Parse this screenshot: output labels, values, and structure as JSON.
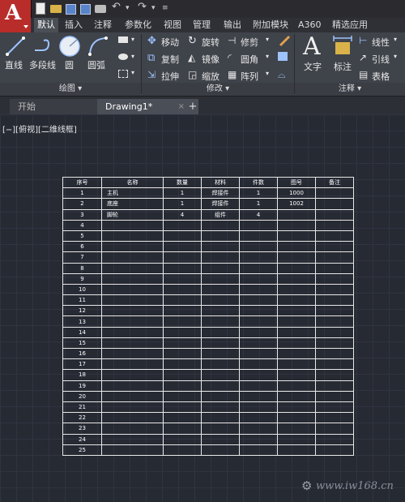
{
  "app": {
    "logo_letter": "A"
  },
  "ribbon_tabs": [
    "默认",
    "插入",
    "注释",
    "参数化",
    "视图",
    "管理",
    "输出",
    "附加模块",
    "A360",
    "精选应用"
  ],
  "draw_panel": {
    "title": "绘图 ▾",
    "tools": {
      "line": "直线",
      "polyline": "多段线",
      "circle": "圆",
      "arc": "圆弧"
    }
  },
  "modify_panel": {
    "title": "修改 ▾",
    "tools": {
      "move": "移动",
      "rotate": "旋转",
      "trim": "修剪",
      "copy": "复制",
      "mirror": "镜像",
      "fillet": "圆角",
      "stretch": "拉伸",
      "scale": "缩放",
      "array": "阵列"
    }
  },
  "annotation_panel": {
    "title": "注释 ▾",
    "tools": {
      "text": "文字",
      "dimension": "标注",
      "linear": "线性",
      "leader": "引线",
      "table": "表格"
    }
  },
  "file_tabs": {
    "start": "开始",
    "drawing": "Drawing1*",
    "close": "×",
    "add": "+"
  },
  "viewport_label": "[−][俯视][二维线框]",
  "bom_table": {
    "headers": [
      "序号",
      "名称",
      "数量",
      "材料",
      "件数",
      "图号",
      "备注"
    ],
    "rows": [
      [
        "1",
        "主机",
        "1",
        "焊接件",
        "1",
        "1000",
        ""
      ],
      [
        "2",
        "底座",
        "1",
        "焊接件",
        "1",
        "1002",
        ""
      ],
      [
        "3",
        "脚轮",
        "4",
        "组件",
        "4",
        "",
        ""
      ],
      [
        "4",
        "",
        "",
        "",
        "",
        "",
        ""
      ],
      [
        "5",
        "",
        "",
        "",
        "",
        "",
        ""
      ],
      [
        "6",
        "",
        "",
        "",
        "",
        "",
        ""
      ],
      [
        "7",
        "",
        "",
        "",
        "",
        "",
        ""
      ],
      [
        "8",
        "",
        "",
        "",
        "",
        "",
        ""
      ],
      [
        "9",
        "",
        "",
        "",
        "",
        "",
        ""
      ],
      [
        "10",
        "",
        "",
        "",
        "",
        "",
        ""
      ],
      [
        "11",
        "",
        "",
        "",
        "",
        "",
        ""
      ],
      [
        "12",
        "",
        "",
        "",
        "",
        "",
        ""
      ],
      [
        "13",
        "",
        "",
        "",
        "",
        "",
        ""
      ],
      [
        "14",
        "",
        "",
        "",
        "",
        "",
        ""
      ],
      [
        "15",
        "",
        "",
        "",
        "",
        "",
        ""
      ],
      [
        "16",
        "",
        "",
        "",
        "",
        "",
        ""
      ],
      [
        "17",
        "",
        "",
        "",
        "",
        "",
        ""
      ],
      [
        "18",
        "",
        "",
        "",
        "",
        "",
        ""
      ],
      [
        "19",
        "",
        "",
        "",
        "",
        "",
        ""
      ],
      [
        "20",
        "",
        "",
        "",
        "",
        "",
        ""
      ],
      [
        "21",
        "",
        "",
        "",
        "",
        "",
        ""
      ],
      [
        "22",
        "",
        "",
        "",
        "",
        "",
        ""
      ],
      [
        "23",
        "",
        "",
        "",
        "",
        "",
        ""
      ],
      [
        "24",
        "",
        "",
        "",
        "",
        "",
        ""
      ],
      [
        "25",
        "",
        "",
        "",
        "",
        "",
        ""
      ]
    ]
  },
  "watermark": "www.iw168.cn",
  "colors": {
    "app_red": "#b82d2a",
    "ribbon": "#3f434a",
    "canvas": "#262a33",
    "table_line": "#e8e8e8"
  }
}
